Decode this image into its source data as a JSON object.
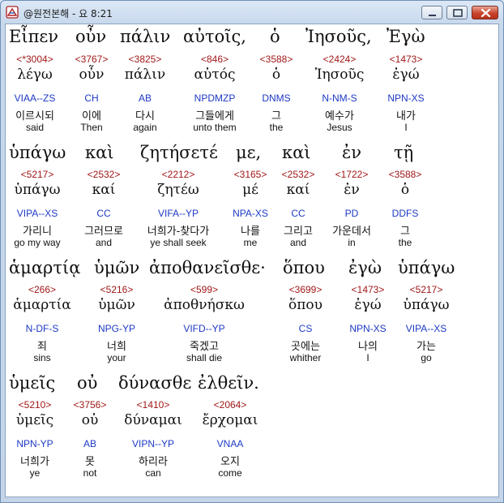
{
  "window": {
    "title": "@원전본해 - 요 8:21"
  },
  "lines": [
    {
      "top_words": [
        "Εἶπεν",
        "οὖν",
        "πάλιν",
        "αὐτοῖς,",
        "ὁ",
        "Ἰησοῦς,",
        "Ἐγὼ"
      ],
      "words": [
        {
          "strong": "<*3004>",
          "lemma": "λέγω",
          "parse": "VIAA--ZS",
          "korean": "이르시되",
          "english": "said"
        },
        {
          "strong": "<3767>",
          "lemma": "οὖν",
          "parse": "CH",
          "korean": "이에",
          "english": "Then"
        },
        {
          "strong": "<3825>",
          "lemma": "πάλιν",
          "parse": "AB",
          "korean": "다시",
          "english": "again"
        },
        {
          "strong": "<846>",
          "lemma": "αὐτός",
          "parse": "NPDMZP",
          "korean": "그들에게",
          "english": "unto them"
        },
        {
          "strong": "<3588>",
          "lemma": "ὁ",
          "parse": "DNMS",
          "korean": "그",
          "english": "the"
        },
        {
          "strong": "<2424>",
          "lemma": "Ἰησοῦς",
          "parse": "N-NM-S",
          "korean": "예수가",
          "english": "Jesus"
        },
        {
          "strong": "<1473>",
          "lemma": "ἐγώ",
          "parse": "NPN-XS",
          "korean": "내가",
          "english": "I"
        }
      ]
    },
    {
      "top_words": [
        "ὑπάγω",
        "καὶ",
        "ζητήσετέ",
        "με,",
        "καὶ",
        "ἐν",
        "τῇ"
      ],
      "words": [
        {
          "strong": "<5217>",
          "lemma": "ὑπάγω",
          "parse": "VIPA--XS",
          "korean": "가리니",
          "english": "go my way"
        },
        {
          "strong": "<2532>",
          "lemma": "καί",
          "parse": "CC",
          "korean": "그러므로",
          "english": "and"
        },
        {
          "strong": "<2212>",
          "lemma": "ζητέω",
          "parse": "VIFA--YP",
          "korean": "너희가-찾다가",
          "english": "ye shall seek"
        },
        {
          "strong": "<3165>",
          "lemma": "μέ",
          "parse": "NPA-XS",
          "korean": "나를",
          "english": "me"
        },
        {
          "strong": "<2532>",
          "lemma": "καί",
          "parse": "CC",
          "korean": "그리고",
          "english": "and"
        },
        {
          "strong": "<1722>",
          "lemma": "ἐν",
          "parse": "PD",
          "korean": "가운데서",
          "english": "in"
        },
        {
          "strong": "<3588>",
          "lemma": "ὁ",
          "parse": "DDFS",
          "korean": "그",
          "english": "the"
        }
      ]
    },
    {
      "top_words": [
        "ἁμαρτίᾳ",
        "ὑμῶν",
        "ἀποθανεῖσθε·",
        "ὅπου",
        "ἐγὼ",
        "ὑπάγω"
      ],
      "words": [
        {
          "strong": "<266>",
          "lemma": "ἁμαρτία",
          "parse": "N-DF-S",
          "korean": "죄",
          "english": "sins"
        },
        {
          "strong": "<5216>",
          "lemma": "ὑμῶν",
          "parse": "NPG-YP",
          "korean": "너희",
          "english": "your"
        },
        {
          "strong": "<599>",
          "lemma": "ἀποθνήσκω",
          "parse": "VIFD--YP",
          "korean": "죽겠고",
          "english": "shall die"
        },
        {
          "strong": "<3699>",
          "lemma": "ὅπου",
          "parse": "CS",
          "korean": "곳에는",
          "english": "whither"
        },
        {
          "strong": "<1473>",
          "lemma": "ἐγώ",
          "parse": "NPN-XS",
          "korean": "나의",
          "english": "I"
        },
        {
          "strong": "<5217>",
          "lemma": "ὑπάγω",
          "parse": "VIPA--XS",
          "korean": "가는",
          "english": "go"
        }
      ]
    },
    {
      "top_words": [
        "ὑμεῖς",
        "οὐ",
        "δύνασθε",
        "ἐλθεῖν."
      ],
      "words": [
        {
          "strong": "<5210>",
          "lemma": "ὑμεῖς",
          "parse": "NPN-YP",
          "korean": "너희가",
          "english": "ye"
        },
        {
          "strong": "<3756>",
          "lemma": "οὐ",
          "parse": "AB",
          "korean": "못",
          "english": "not"
        },
        {
          "strong": "<1410>",
          "lemma": "δύναμαι",
          "parse": "VIPN--YP",
          "korean": "하리라",
          "english": "can"
        },
        {
          "strong": "<2064>",
          "lemma": "ἔρχομαι",
          "parse": "VNAA",
          "korean": "오지",
          "english": "come"
        }
      ]
    }
  ]
}
